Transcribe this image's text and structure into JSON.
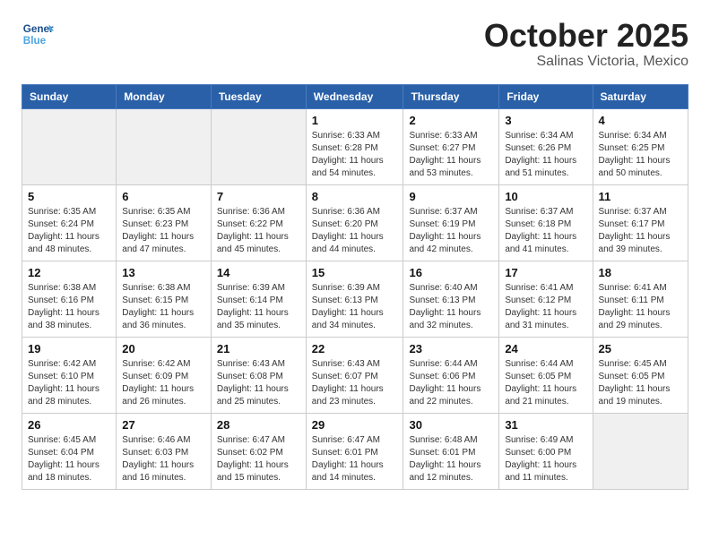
{
  "header": {
    "logo_line1": "General",
    "logo_line2": "Blue",
    "month": "October 2025",
    "location": "Salinas Victoria, Mexico"
  },
  "days_of_week": [
    "Sunday",
    "Monday",
    "Tuesday",
    "Wednesday",
    "Thursday",
    "Friday",
    "Saturday"
  ],
  "weeks": [
    [
      {
        "day": "",
        "info": ""
      },
      {
        "day": "",
        "info": ""
      },
      {
        "day": "",
        "info": ""
      },
      {
        "day": "1",
        "info": "Sunrise: 6:33 AM\nSunset: 6:28 PM\nDaylight: 11 hours\nand 54 minutes."
      },
      {
        "day": "2",
        "info": "Sunrise: 6:33 AM\nSunset: 6:27 PM\nDaylight: 11 hours\nand 53 minutes."
      },
      {
        "day": "3",
        "info": "Sunrise: 6:34 AM\nSunset: 6:26 PM\nDaylight: 11 hours\nand 51 minutes."
      },
      {
        "day": "4",
        "info": "Sunrise: 6:34 AM\nSunset: 6:25 PM\nDaylight: 11 hours\nand 50 minutes."
      }
    ],
    [
      {
        "day": "5",
        "info": "Sunrise: 6:35 AM\nSunset: 6:24 PM\nDaylight: 11 hours\nand 48 minutes."
      },
      {
        "day": "6",
        "info": "Sunrise: 6:35 AM\nSunset: 6:23 PM\nDaylight: 11 hours\nand 47 minutes."
      },
      {
        "day": "7",
        "info": "Sunrise: 6:36 AM\nSunset: 6:22 PM\nDaylight: 11 hours\nand 45 minutes."
      },
      {
        "day": "8",
        "info": "Sunrise: 6:36 AM\nSunset: 6:20 PM\nDaylight: 11 hours\nand 44 minutes."
      },
      {
        "day": "9",
        "info": "Sunrise: 6:37 AM\nSunset: 6:19 PM\nDaylight: 11 hours\nand 42 minutes."
      },
      {
        "day": "10",
        "info": "Sunrise: 6:37 AM\nSunset: 6:18 PM\nDaylight: 11 hours\nand 41 minutes."
      },
      {
        "day": "11",
        "info": "Sunrise: 6:37 AM\nSunset: 6:17 PM\nDaylight: 11 hours\nand 39 minutes."
      }
    ],
    [
      {
        "day": "12",
        "info": "Sunrise: 6:38 AM\nSunset: 6:16 PM\nDaylight: 11 hours\nand 38 minutes."
      },
      {
        "day": "13",
        "info": "Sunrise: 6:38 AM\nSunset: 6:15 PM\nDaylight: 11 hours\nand 36 minutes."
      },
      {
        "day": "14",
        "info": "Sunrise: 6:39 AM\nSunset: 6:14 PM\nDaylight: 11 hours\nand 35 minutes."
      },
      {
        "day": "15",
        "info": "Sunrise: 6:39 AM\nSunset: 6:13 PM\nDaylight: 11 hours\nand 34 minutes."
      },
      {
        "day": "16",
        "info": "Sunrise: 6:40 AM\nSunset: 6:13 PM\nDaylight: 11 hours\nand 32 minutes."
      },
      {
        "day": "17",
        "info": "Sunrise: 6:41 AM\nSunset: 6:12 PM\nDaylight: 11 hours\nand 31 minutes."
      },
      {
        "day": "18",
        "info": "Sunrise: 6:41 AM\nSunset: 6:11 PM\nDaylight: 11 hours\nand 29 minutes."
      }
    ],
    [
      {
        "day": "19",
        "info": "Sunrise: 6:42 AM\nSunset: 6:10 PM\nDaylight: 11 hours\nand 28 minutes."
      },
      {
        "day": "20",
        "info": "Sunrise: 6:42 AM\nSunset: 6:09 PM\nDaylight: 11 hours\nand 26 minutes."
      },
      {
        "day": "21",
        "info": "Sunrise: 6:43 AM\nSunset: 6:08 PM\nDaylight: 11 hours\nand 25 minutes."
      },
      {
        "day": "22",
        "info": "Sunrise: 6:43 AM\nSunset: 6:07 PM\nDaylight: 11 hours\nand 23 minutes."
      },
      {
        "day": "23",
        "info": "Sunrise: 6:44 AM\nSunset: 6:06 PM\nDaylight: 11 hours\nand 22 minutes."
      },
      {
        "day": "24",
        "info": "Sunrise: 6:44 AM\nSunset: 6:05 PM\nDaylight: 11 hours\nand 21 minutes."
      },
      {
        "day": "25",
        "info": "Sunrise: 6:45 AM\nSunset: 6:05 PM\nDaylight: 11 hours\nand 19 minutes."
      }
    ],
    [
      {
        "day": "26",
        "info": "Sunrise: 6:45 AM\nSunset: 6:04 PM\nDaylight: 11 hours\nand 18 minutes."
      },
      {
        "day": "27",
        "info": "Sunrise: 6:46 AM\nSunset: 6:03 PM\nDaylight: 11 hours\nand 16 minutes."
      },
      {
        "day": "28",
        "info": "Sunrise: 6:47 AM\nSunset: 6:02 PM\nDaylight: 11 hours\nand 15 minutes."
      },
      {
        "day": "29",
        "info": "Sunrise: 6:47 AM\nSunset: 6:01 PM\nDaylight: 11 hours\nand 14 minutes."
      },
      {
        "day": "30",
        "info": "Sunrise: 6:48 AM\nSunset: 6:01 PM\nDaylight: 11 hours\nand 12 minutes."
      },
      {
        "day": "31",
        "info": "Sunrise: 6:49 AM\nSunset: 6:00 PM\nDaylight: 11 hours\nand 11 minutes."
      },
      {
        "day": "",
        "info": ""
      }
    ]
  ]
}
